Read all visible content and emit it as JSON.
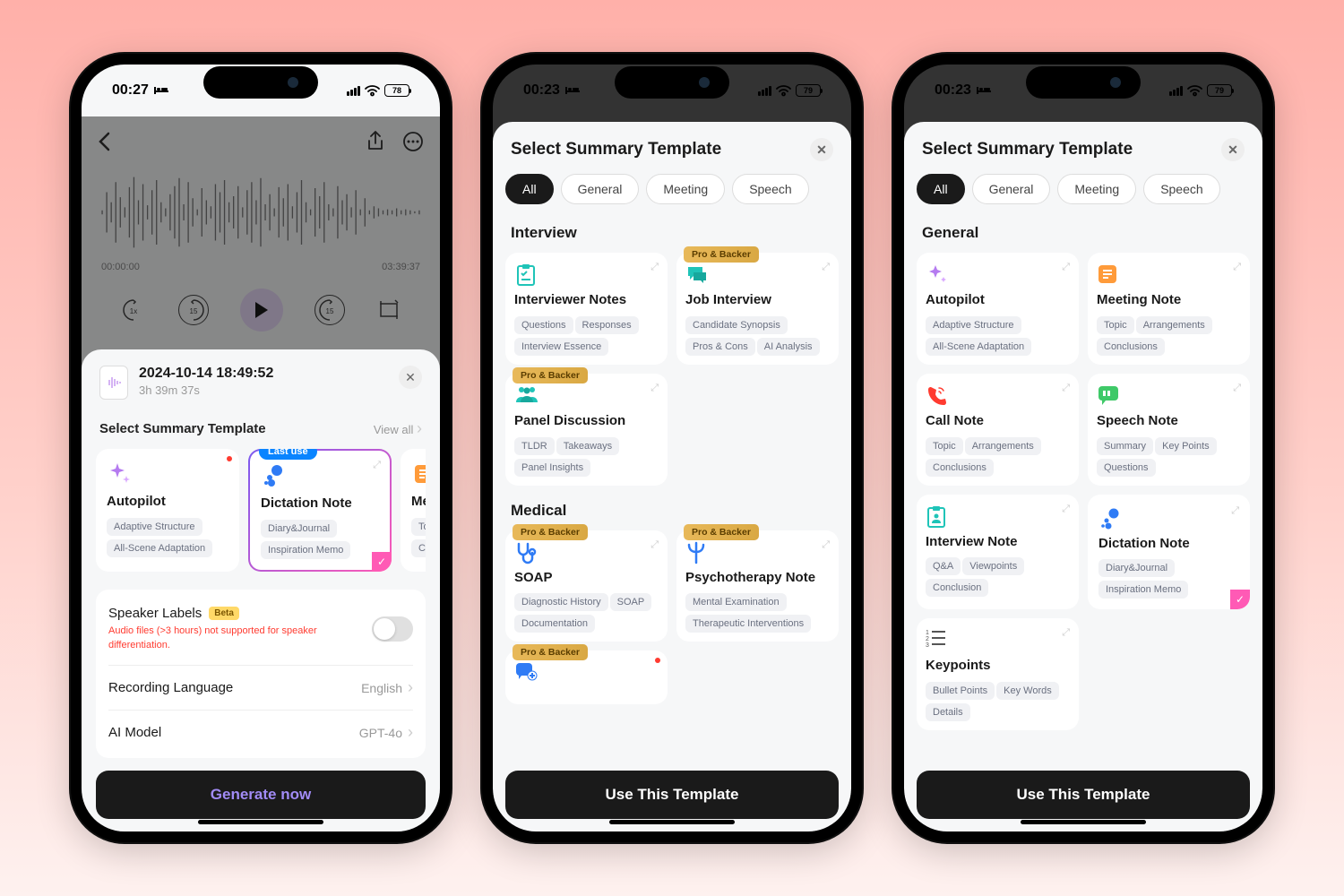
{
  "p1": {
    "status": {
      "time": "00:27",
      "batt": "78"
    },
    "rec": {
      "t0": "00:00:00",
      "t1": "03:39:37",
      "title": "2024-10-14 18:49:52",
      "dur": "3h 39m 37s"
    },
    "sheet_title": "Select Summary Template",
    "view_all": "View all",
    "cards": {
      "autopilot": {
        "title": "Autopilot",
        "c1": "Adaptive Structure",
        "c2": "All-Scene Adaptation"
      },
      "dictation": {
        "title": "Dictation Note",
        "badge": "Last use",
        "c1": "Diary&Journal",
        "c2": "Inspiration Memo"
      },
      "meeting": {
        "title": "Me",
        "c1": "To",
        "c2": "Co"
      }
    },
    "opts": {
      "sl_title": "Speaker Labels",
      "sl_beta": "Beta",
      "sl_sub": "Audio files (>3 hours) not supported for speaker differentiation.",
      "rl_title": "Recording Language",
      "rl_val": "English",
      "ai_title": "AI Model",
      "ai_val": "GPT-4o"
    },
    "gen": "Generate now"
  },
  "p2": {
    "status": {
      "time": "00:23",
      "batt": "79"
    },
    "title": "Select Summary Template",
    "tabs": [
      "All",
      "General",
      "Meeting",
      "Speech"
    ],
    "cat1": "Interview",
    "cat2": "Medical",
    "pro": "Pro & Backer",
    "t1": {
      "title": "Interviewer Notes",
      "c1": "Questions",
      "c2": "Responses",
      "c3": "Interview Essence"
    },
    "t2": {
      "title": "Job Interview",
      "c1": "Candidate Synopsis",
      "c2": "Pros & Cons",
      "c3": "AI Analysis"
    },
    "t3": {
      "title": "Panel Discussion",
      "c1": "TLDR",
      "c2": "Takeaways",
      "c3": "Panel Insights"
    },
    "t4": {
      "title": "SOAP",
      "c1": "Diagnostic History",
      "c2": "SOAP",
      "c3": "Documentation"
    },
    "t5": {
      "title": "Psychotherapy Note",
      "c1": "Mental Examination",
      "c2": "Therapeutic Interventions"
    },
    "btn": "Use This Template"
  },
  "p3": {
    "status": {
      "time": "00:23",
      "batt": "79"
    },
    "title": "Select Summary Template",
    "tabs": [
      "All",
      "General",
      "Meeting",
      "Speech"
    ],
    "cat": "General",
    "t1": {
      "title": "Autopilot",
      "c1": "Adaptive Structure",
      "c2": "All-Scene Adaptation"
    },
    "t2": {
      "title": "Meeting Note",
      "c1": "Topic",
      "c2": "Arrangements",
      "c3": "Conclusions"
    },
    "t3": {
      "title": "Call Note",
      "c1": "Topic",
      "c2": "Arrangements",
      "c3": "Conclusions"
    },
    "t4": {
      "title": "Speech Note",
      "c1": "Summary",
      "c2": "Key Points",
      "c3": "Questions"
    },
    "t5": {
      "title": "Interview Note",
      "c1": "Q&A",
      "c2": "Viewpoints",
      "c3": "Conclusion"
    },
    "t6": {
      "title": "Dictation Note",
      "c1": "Diary&Journal",
      "c2": "Inspiration Memo"
    },
    "t7": {
      "title": "Keypoints",
      "c1": "Bullet Points",
      "c2": "Key Words",
      "c3": "Details"
    },
    "btn": "Use This Template"
  }
}
